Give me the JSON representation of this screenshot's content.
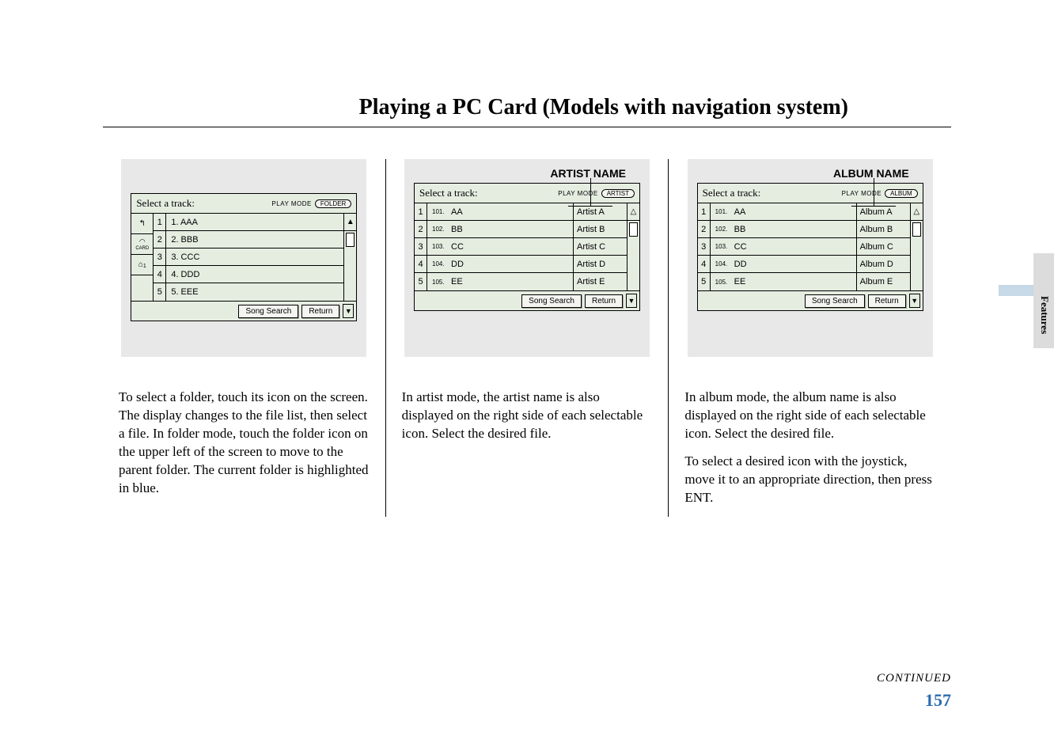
{
  "title": "Playing a PC Card (Models with navigation system)",
  "sideTab": "Features",
  "continued": "CONTINUED",
  "pageNumber": "157",
  "columns": {
    "left": {
      "paragraph": "To select a folder, touch its icon on the screen. The display changes to the file list, then select a file. In folder mode, touch the folder icon on the upper left of the screen to move to the parent folder. The current folder is highlighted in blue.",
      "screen": {
        "header": "Select a track:",
        "playModeLabel": "PLAY MODE",
        "modeBubble": "FOLDER",
        "rows": [
          {
            "idx": "1",
            "label": "1. AAA"
          },
          {
            "idx": "2",
            "label": "2. BBB"
          },
          {
            "idx": "3",
            "label": "3. CCC"
          },
          {
            "idx": "4",
            "label": "4. DDD"
          },
          {
            "idx": "5",
            "label": "5. EEE"
          }
        ],
        "footerButtons": {
          "songSearch": "Song Search",
          "return": "Return"
        },
        "leftIcons": {
          "up": "↰",
          "card": "CARD",
          "folder": "📁"
        }
      }
    },
    "middle": {
      "label": "ARTIST NAME",
      "paragraph": "In artist mode, the artist name is also displayed on the right side of each selectable icon. Select the desired file.",
      "screen": {
        "header": "Select a track:",
        "playModeLabel": "PLAY MODE",
        "modeBubble": "ARTIST",
        "rows": [
          {
            "idx": "1",
            "num": "101.",
            "label": "AA",
            "sec": "Artist A"
          },
          {
            "idx": "2",
            "num": "102.",
            "label": "BB",
            "sec": "Artist B"
          },
          {
            "idx": "3",
            "num": "103.",
            "label": "CC",
            "sec": "Artist C"
          },
          {
            "idx": "4",
            "num": "104.",
            "label": "DD",
            "sec": "Artist D"
          },
          {
            "idx": "5",
            "num": "105.",
            "label": "EE",
            "sec": "Artist E"
          }
        ],
        "footerButtons": {
          "songSearch": "Song Search",
          "return": "Return"
        }
      }
    },
    "right": {
      "label": "ALBUM NAME",
      "paragraph1": "In album mode, the album name is also displayed on the right side of each selectable icon. Select the desired file.",
      "paragraph2": "To select a desired icon with the joystick, move it to an appropriate direction, then press ENT.",
      "screen": {
        "header": "Select a track:",
        "playModeLabel": "PLAY MODE",
        "modeBubble": "ALBUM",
        "rows": [
          {
            "idx": "1",
            "num": "101.",
            "label": "AA",
            "sec": "Album A"
          },
          {
            "idx": "2",
            "num": "102.",
            "label": "BB",
            "sec": "Album B"
          },
          {
            "idx": "3",
            "num": "103.",
            "label": "CC",
            "sec": "Album C"
          },
          {
            "idx": "4",
            "num": "104.",
            "label": "DD",
            "sec": "Album D"
          },
          {
            "idx": "5",
            "num": "105.",
            "label": "EE",
            "sec": "Album E"
          }
        ],
        "footerButtons": {
          "songSearch": "Song Search",
          "return": "Return"
        }
      }
    }
  }
}
